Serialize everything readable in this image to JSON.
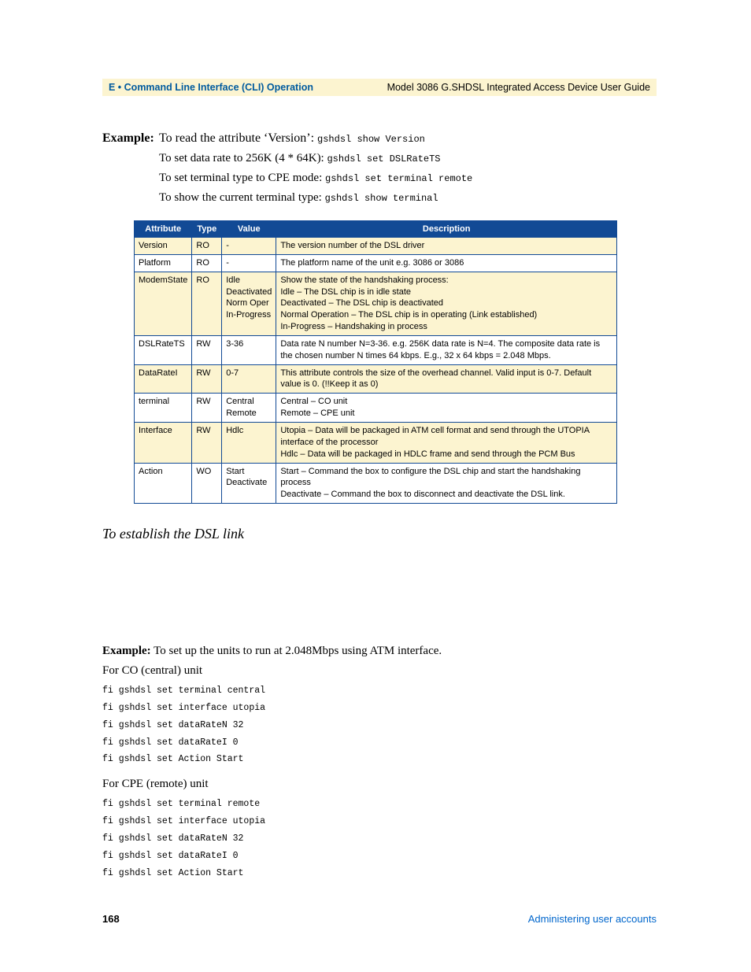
{
  "header": {
    "left": "E • Command Line Interface (CLI) Operation",
    "right": "Model 3086 G.SHDSL Integrated Access Device User Guide"
  },
  "example": {
    "label": "Example:",
    "lines": [
      {
        "text": "To read the attribute ‘Version’: ",
        "cmd": "gshdsl show Version"
      },
      {
        "text": "To set data rate to 256K (4 * 64K): ",
        "cmd": "gshdsl set DSLRateTS"
      },
      {
        "text": "To set terminal type to CPE mode: ",
        "cmd": "gshdsl set terminal remote"
      },
      {
        "text": "To show the current terminal type: ",
        "cmd": "gshdsl show terminal"
      }
    ]
  },
  "table": {
    "headers": [
      "Attribute",
      "Type",
      "Value",
      "Description"
    ],
    "rows": [
      {
        "hl": true,
        "c": [
          "Version",
          "RO",
          "-",
          "The version number of the DSL driver"
        ]
      },
      {
        "hl": false,
        "c": [
          "Platform",
          "RO",
          "-",
          "The platform name of the unit e.g. 3086 or 3086"
        ]
      },
      {
        "hl": true,
        "c": [
          "ModemState",
          "RO",
          "Idle\nDeactivated\nNorm Oper\nIn-Progress",
          "Show the state of the handshaking process:\nIdle – The DSL chip is in idle state\nDeactivated – The DSL chip is deactivated\nNormal Operation – The DSL chip is in operating (Link established)\nIn-Progress – Handshaking in process\n "
        ]
      },
      {
        "hl": false,
        "c": [
          "DSLRateTS",
          "RW",
          "3-36",
          "Data rate N number N=3-36. e.g. 256K data rate is N=4. The composite data rate is the chosen number N times 64 kbps. E.g., 32 x 64 kbps = 2.048 Mbps."
        ]
      },
      {
        "hl": true,
        "c": [
          "DataRateI",
          "RW",
          "0-7",
          "This attribute controls the size of the overhead channel. Valid input is 0-7. Default value is 0. (!!Keep it as 0)"
        ]
      },
      {
        "hl": false,
        "c": [
          "terminal",
          "RW",
          "Central\nRemote",
          "Central – CO unit\nRemote – CPE unit"
        ]
      },
      {
        "hl": true,
        "c": [
          "Interface",
          "RW",
          "Hdlc",
          "Utopia – Data will be packaged in ATM cell format and send through the UTOPIA interface of the processor\nHdlc – Data will be packaged in HDLC frame and send through the PCM Bus"
        ]
      },
      {
        "hl": false,
        "c": [
          "Action",
          "WO",
          "Start\nDeactivate",
          "Start – Command the box to configure the DSL chip and start the handshaking process\nDeactivate – Command the box to disconnect and deactivate the DSL link."
        ]
      }
    ]
  },
  "section_heading": "To establish the DSL link",
  "example2": {
    "label": "Example:",
    "text": "To set up the units to run at 2.048Mbps using ATM interface."
  },
  "co": {
    "heading": "For CO (central) unit",
    "cmds": [
      "fi  gshdsl set terminal central",
      "fi  gshdsl set interface utopia",
      "fi  gshdsl set dataRateN 32",
      "fi  gshdsl set dataRateI 0",
      "fi  gshdsl set Action Start"
    ]
  },
  "cpe": {
    "heading": "For CPE (remote) unit",
    "cmds": [
      "fi  gshdsl set terminal remote",
      "fi  gshdsl set interface utopia",
      "fi  gshdsl set dataRateN 32",
      "fi  gshdsl set dataRateI 0",
      "fi  gshdsl set Action Start"
    ]
  },
  "footer": {
    "page": "168",
    "link": "Administering user accounts"
  }
}
